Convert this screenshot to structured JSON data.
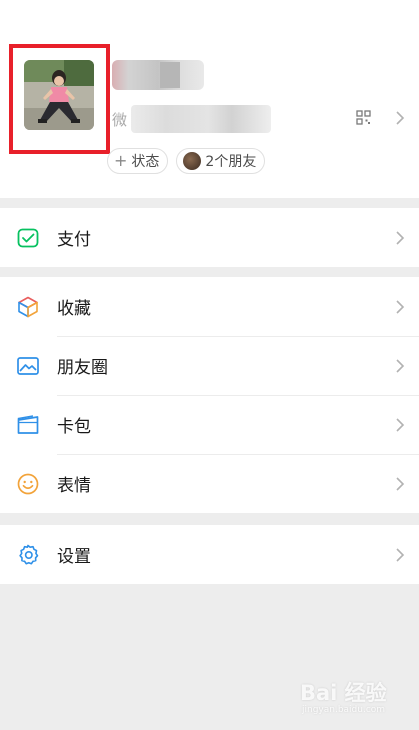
{
  "profile": {
    "wxid_label": "微",
    "status_button": "状态",
    "status_prefix": "+",
    "friends_button": "2个朋友"
  },
  "menu": {
    "pay": "支付",
    "favorites": "收藏",
    "moments": "朋友圈",
    "cards": "卡包",
    "stickers": "表情",
    "settings": "设置"
  },
  "icons": {
    "pay": "pay-check-icon",
    "favorites": "cube-icon",
    "moments": "landscape-image-icon",
    "cards": "card-icon",
    "stickers": "smiley-icon",
    "settings": "gear-icon",
    "qr": "qr-code-icon",
    "chevron": "chevron-right-icon"
  },
  "colors": {
    "highlight": "#e8202a",
    "pay_green": "#07c160",
    "blue": "#2f90e8",
    "orange": "#f2a33a"
  },
  "watermark": {
    "brand": "Bai 经验",
    "url": "jingyan.baidu.com"
  }
}
